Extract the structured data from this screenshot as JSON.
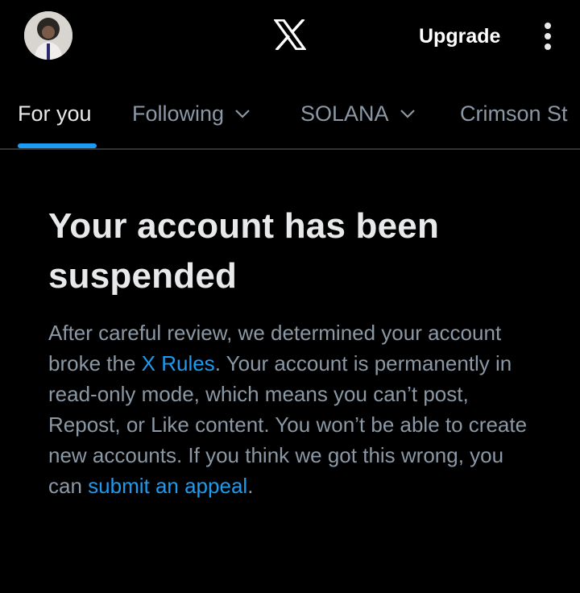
{
  "topbar": {
    "avatar_icon": "profile-avatar",
    "logo_icon": "x-logo-icon",
    "upgrade_label": "Upgrade",
    "more_icon": "more-vertical-icon"
  },
  "tabs": [
    {
      "label": "For you",
      "active": true,
      "has_dropdown": false
    },
    {
      "label": "Following",
      "active": false,
      "has_dropdown": true
    },
    {
      "label": "SOLANA",
      "active": false,
      "has_dropdown": true
    },
    {
      "label": "Crimson St",
      "active": false,
      "has_dropdown": false
    }
  ],
  "notice": {
    "title": "Your account has been suspended",
    "body_1": "After careful review, we determined your account broke the ",
    "rules_link": "X Rules",
    "body_2": ". Your account is permanently in read-only mode, which means you can’t post, Repost, or Like content. You won’t be able to create new accounts. If you think we got this wrong, you can ",
    "appeal_link": "submit an appeal",
    "body_3": "."
  },
  "colors": {
    "background": "#000000",
    "text_primary": "#e7e9ea",
    "text_secondary": "#8b98a5",
    "accent": "#1d9bf0",
    "divider": "#2f3336"
  }
}
